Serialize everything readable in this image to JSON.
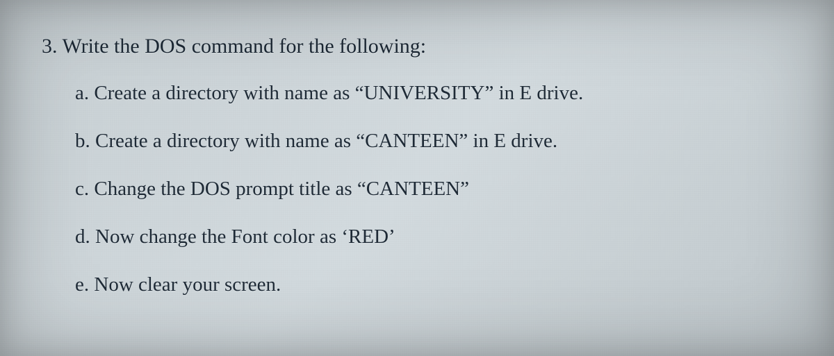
{
  "question": {
    "number": "3",
    "heading": "3. Write the DOS command for the following:",
    "items": [
      {
        "label": "a",
        "text": "a. Create a directory with name as “UNIVERSITY” in E drive."
      },
      {
        "label": "b",
        "text": "b. Create a directory with name as “CANTEEN” in E drive."
      },
      {
        "label": "c",
        "text": "c. Change the DOS prompt title as “CANTEEN”"
      },
      {
        "label": "d",
        "text": "d. Now change the Font color as ‘RED’"
      },
      {
        "label": "e",
        "text": "e. Now clear your screen."
      }
    ]
  }
}
